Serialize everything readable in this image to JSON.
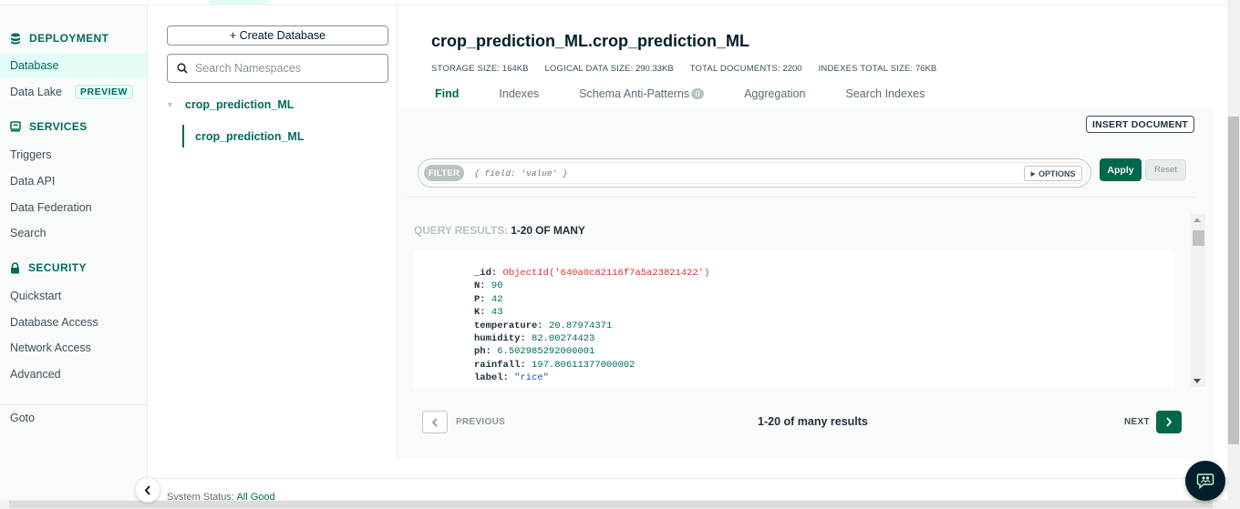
{
  "sidebar": {
    "deployment_heading": "DEPLOYMENT",
    "database": "Database",
    "data_lake": "Data Lake",
    "preview_badge": "PREVIEW",
    "services_heading": "SERVICES",
    "triggers": "Triggers",
    "data_api": "Data API",
    "data_federation": "Data Federation",
    "search": "Search",
    "security_heading": "SECURITY",
    "quickstart": "Quickstart",
    "database_access": "Database Access",
    "network_access": "Network Access",
    "advanced": "Advanced",
    "goto": "Goto"
  },
  "namespaces": {
    "create_db_label": "+ Create Database",
    "search_placeholder": "Search Namespaces",
    "database_name": "crop_prediction_ML",
    "collection_name": "crop_prediction_ML"
  },
  "collection": {
    "title": "crop_prediction_ML.crop_prediction_ML",
    "stats": [
      {
        "label": "STORAGE SIZE:",
        "value": "164KB"
      },
      {
        "label": "LOGICAL DATA SIZE:",
        "value": "290.33KB"
      },
      {
        "label": "TOTAL DOCUMENTS:",
        "value": "2200"
      },
      {
        "label": "INDEXES TOTAL SIZE:",
        "value": "76KB"
      }
    ],
    "tabs": {
      "find": "Find",
      "indexes": "Indexes",
      "schema_anti_patterns": "Schema Anti-Patterns",
      "schema_count": "0",
      "aggregation": "Aggregation",
      "search_indexes": "Search Indexes"
    }
  },
  "query": {
    "insert_document": "INSERT DOCUMENT",
    "filter_label": "FILTER",
    "filter_placeholder": "{ field: 'value' }",
    "options": "OPTIONS",
    "apply": "Apply",
    "reset": "Reset",
    "results_label": "QUERY RESULTS:",
    "results_range": "1-20 OF MANY"
  },
  "document": {
    "id_key": "_id:",
    "id_value": "ObjectId('640a0c82116f7a5a23821422')",
    "fields": [
      {
        "key": "N:",
        "value": "90",
        "type": "num"
      },
      {
        "key": "P:",
        "value": "42",
        "type": "num"
      },
      {
        "key": "K:",
        "value": "43",
        "type": "num"
      },
      {
        "key": "temperature:",
        "value": "20.87974371",
        "type": "num"
      },
      {
        "key": "humidity:",
        "value": "82.00274423",
        "type": "num"
      },
      {
        "key": "ph:",
        "value": "6.502985292000001",
        "type": "num"
      },
      {
        "key": "rainfall:",
        "value": "197.80611377000002",
        "type": "num"
      },
      {
        "key": "label:",
        "value": "\"rice\"",
        "type": "str"
      }
    ]
  },
  "pagination": {
    "previous": "PREVIOUS",
    "summary": "1-20 of many results",
    "next": "NEXT"
  },
  "status": {
    "label": "System Status:",
    "value": "All Good"
  },
  "colors": {
    "brand_green": "#00684a",
    "nav_green": "#016b5d",
    "objectid_red": "#db3030",
    "string_blue": "#1254b7"
  }
}
